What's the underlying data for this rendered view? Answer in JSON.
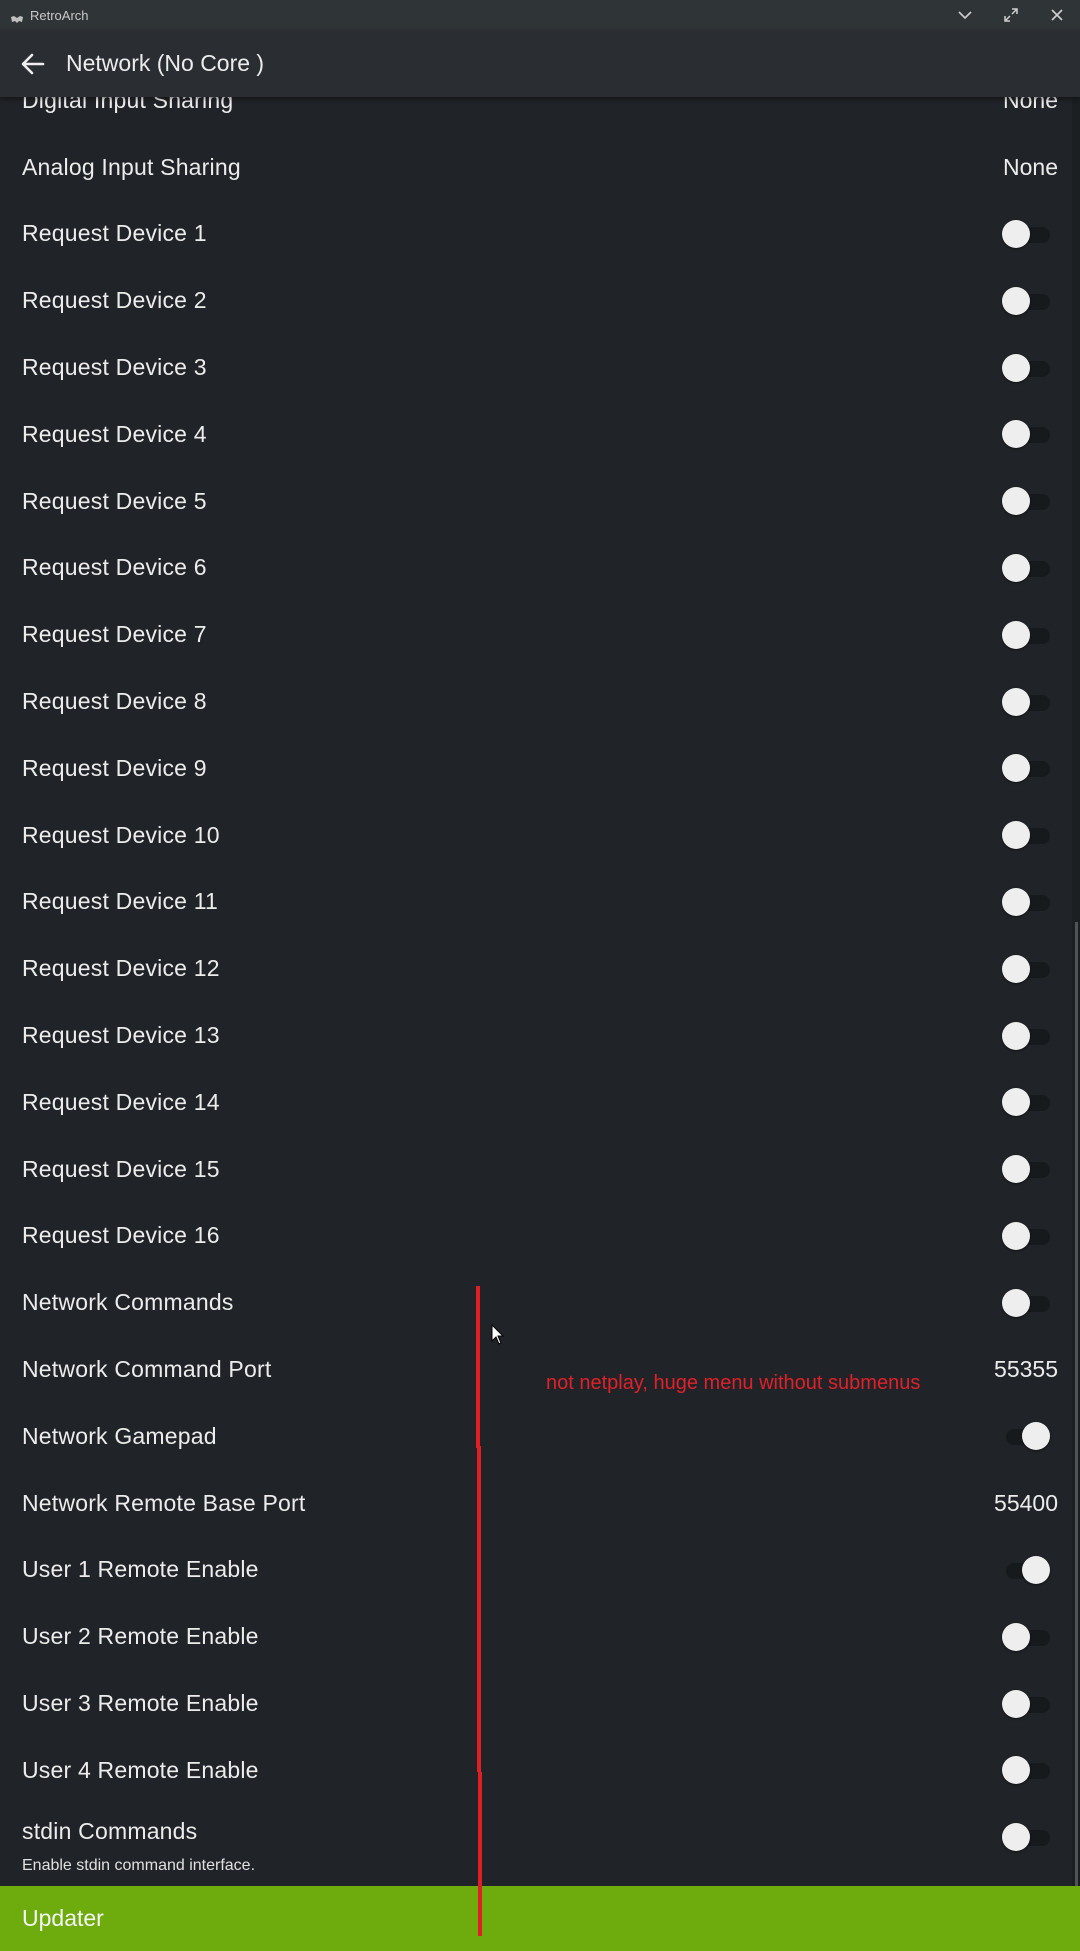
{
  "window": {
    "app_title": "RetroArch",
    "controls": [
      "chevron-down-icon",
      "maximize-icon",
      "close-icon"
    ]
  },
  "header": {
    "title": "Network (No Core )"
  },
  "settings": [
    {
      "label": "Digital Input Sharing",
      "value": "None"
    },
    {
      "label": "Analog Input Sharing",
      "value": "None"
    },
    {
      "label": "Request Device 1",
      "toggle": "off"
    },
    {
      "label": "Request Device 2",
      "toggle": "off"
    },
    {
      "label": "Request Device 3",
      "toggle": "off"
    },
    {
      "label": "Request Device 4",
      "toggle": "off"
    },
    {
      "label": "Request Device 5",
      "toggle": "off"
    },
    {
      "label": "Request Device 6",
      "toggle": "off"
    },
    {
      "label": "Request Device 7",
      "toggle": "off"
    },
    {
      "label": "Request Device 8",
      "toggle": "off"
    },
    {
      "label": "Request Device 9",
      "toggle": "off"
    },
    {
      "label": "Request Device 10",
      "toggle": "off"
    },
    {
      "label": "Request Device 11",
      "toggle": "off"
    },
    {
      "label": "Request Device 12",
      "toggle": "off"
    },
    {
      "label": "Request Device 13",
      "toggle": "off"
    },
    {
      "label": "Request Device 14",
      "toggle": "off"
    },
    {
      "label": "Request Device 15",
      "toggle": "off"
    },
    {
      "label": "Request Device 16",
      "toggle": "off"
    },
    {
      "label": "Network Commands",
      "toggle": "off"
    },
    {
      "label": "Network Command Port",
      "value": "55355"
    },
    {
      "label": "Network Gamepad",
      "toggle": "on"
    },
    {
      "label": "Network Remote Base Port",
      "value": "55400"
    },
    {
      "label": "User 1 Remote Enable",
      "toggle": "on"
    },
    {
      "label": "User 2 Remote Enable",
      "toggle": "off"
    },
    {
      "label": "User 3 Remote Enable",
      "toggle": "off"
    },
    {
      "label": "User 4 Remote Enable",
      "toggle": "off"
    }
  ],
  "stdin_row": {
    "label": "stdin Commands",
    "sublabel": "Enable stdin command interface.",
    "toggle": "off"
  },
  "footer": {
    "label": "Updater"
  },
  "annotation": {
    "text": "not netplay, huge menu without submenus",
    "color": "#e0212a"
  },
  "colors": {
    "background": "#202327",
    "header": "#2a2e33",
    "titlebar": "#2f3437",
    "footer_accent": "#6eab0c"
  }
}
